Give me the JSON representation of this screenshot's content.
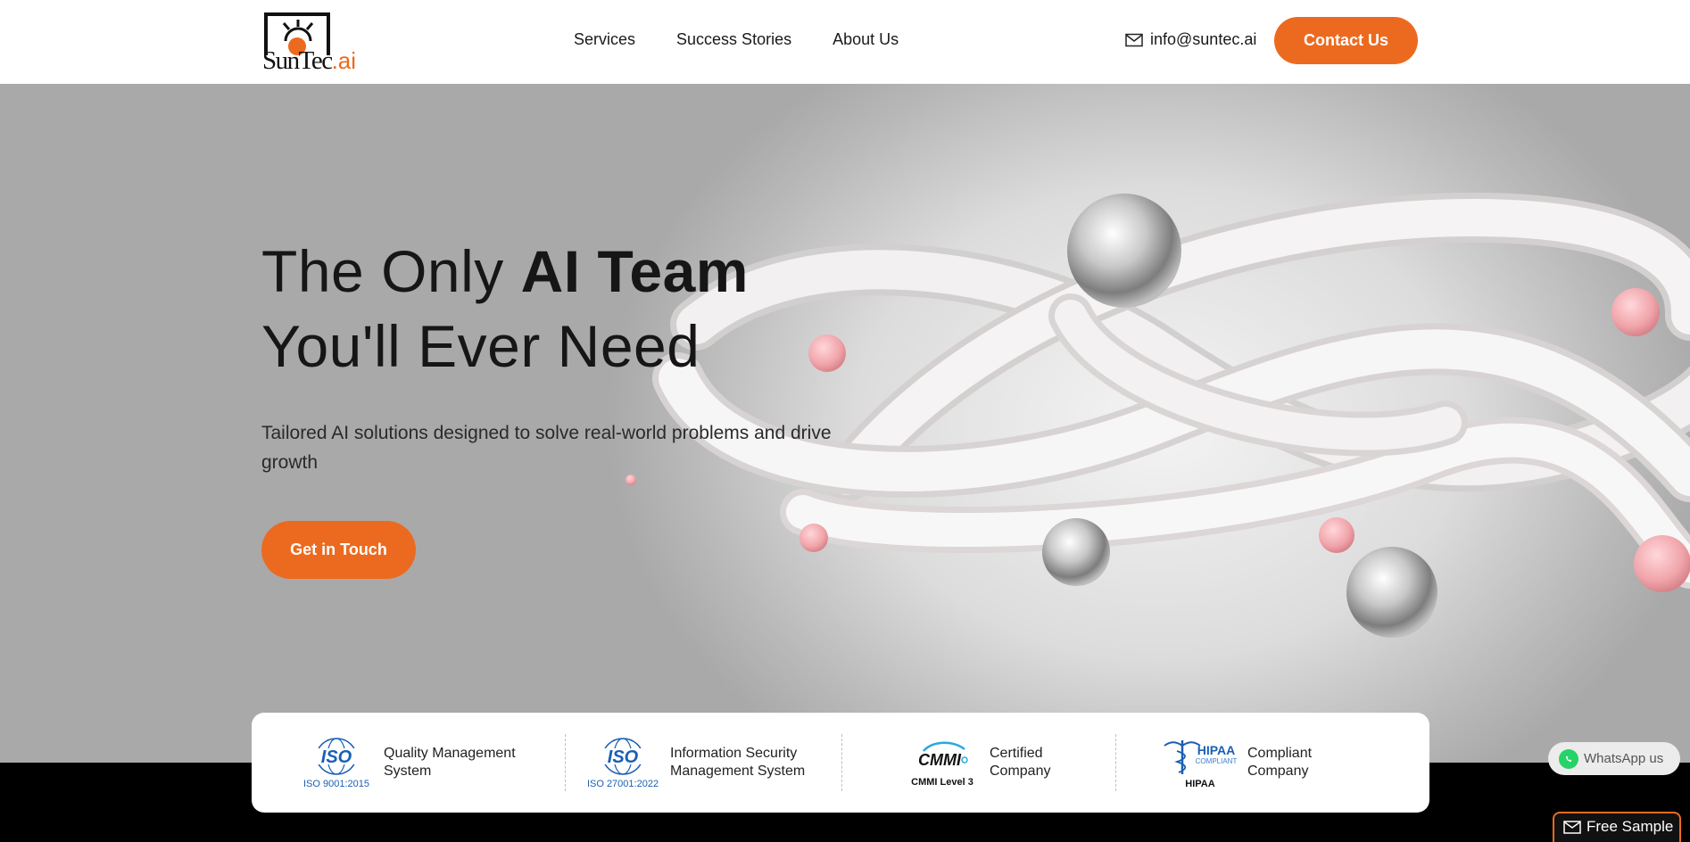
{
  "header": {
    "logo": {
      "name": "SunTec",
      "suffix": ".ai"
    },
    "nav": [
      "Services",
      "Success Stories",
      "About Us"
    ],
    "email": "info@suntec.ai",
    "contact_label": "Contact Us"
  },
  "hero": {
    "headline_part1": "The Only ",
    "headline_bold": "AI Team",
    "headline_line2": "You'll Ever Need",
    "subtext": "Tailored AI solutions designed to solve real-world problems and drive growth",
    "cta_label": "Get in Touch"
  },
  "certifications": [
    {
      "logo": "ISO",
      "caption": "ISO 9001:2015",
      "line1": "Quality Management",
      "line2": "System"
    },
    {
      "logo": "ISO",
      "caption": "ISO 27001:2022",
      "line1": "Information Security",
      "line2": "Management System"
    },
    {
      "logo": "CMMI",
      "caption": "CMMI Level 3",
      "line1": "Certified",
      "line2": "Company"
    },
    {
      "logo": "HIPAA",
      "logo_sub": "COMPLIANT",
      "caption": "HIPAA",
      "line1": "Compliant",
      "line2": "Company"
    }
  ],
  "widgets": {
    "whatsapp_label": "WhatsApp us",
    "free_sample_label": "Free Sample"
  },
  "colors": {
    "accent": "#ec6a1f",
    "dark": "#111111",
    "iso_blue": "#1a5fb4"
  },
  "icons": [
    "mail-icon",
    "globe-icon",
    "caduceus-icon",
    "whatsapp-icon"
  ]
}
